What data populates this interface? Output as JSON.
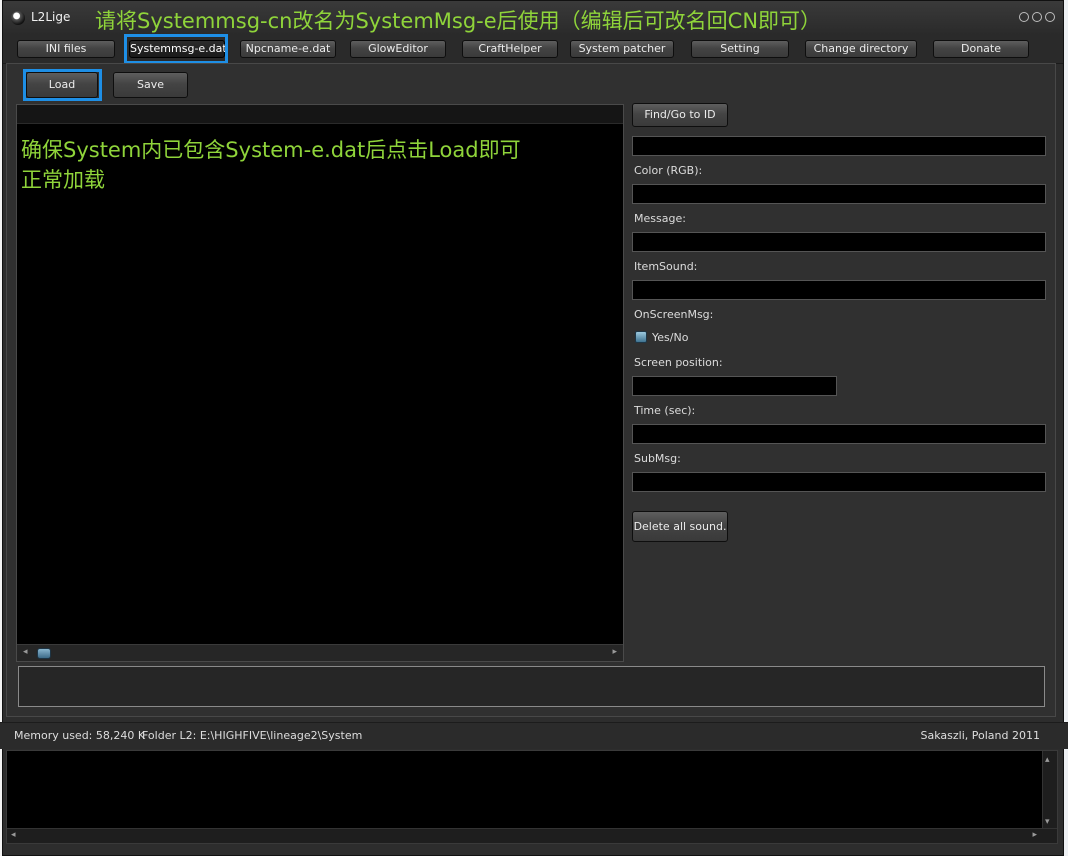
{
  "window": {
    "title": "L2Lige"
  },
  "annotation": {
    "title": "请将Systemmsg-cn改名为SystemMsg-e后使用（编辑后可改名回CN即可）",
    "note_line1": "确保System内已包含System-e.dat后点击Load即可",
    "note_line2": "正常加载"
  },
  "tabs": [
    {
      "label": "INI files"
    },
    {
      "label": "Systemmsg-e.dat",
      "active": true
    },
    {
      "label": "Npcname-e.dat"
    },
    {
      "label": "GlowEditor"
    },
    {
      "label": "CraftHelper"
    },
    {
      "label": "System patcher"
    },
    {
      "label": "Setting"
    },
    {
      "label": "Change directory"
    },
    {
      "label": "Donate"
    }
  ],
  "actions": {
    "load": "Load",
    "save": "Save"
  },
  "editor": {
    "find_button": "Find/Go to ID",
    "color_label": "Color (RGB):",
    "message_label": "Message:",
    "itemsound_label": "ItemSound:",
    "onscreenmsg_label": "OnScreenMsg:",
    "yesno_label": "Yes/No",
    "screen_position_label": "Screen position:",
    "time_label": "Time (sec):",
    "submsg_label": "SubMsg:",
    "delete_sound_button": "Delete all sound."
  },
  "status": {
    "memory": "Memory used: 58,240 K",
    "folder": "Folder L2: E:\\HIGHFIVE\\lineage2\\System",
    "credit": "Sakaszli, Poland 2011"
  },
  "colors": {
    "accent_highlight": "#1e8fe6",
    "annotation_green": "#8fd43a"
  }
}
